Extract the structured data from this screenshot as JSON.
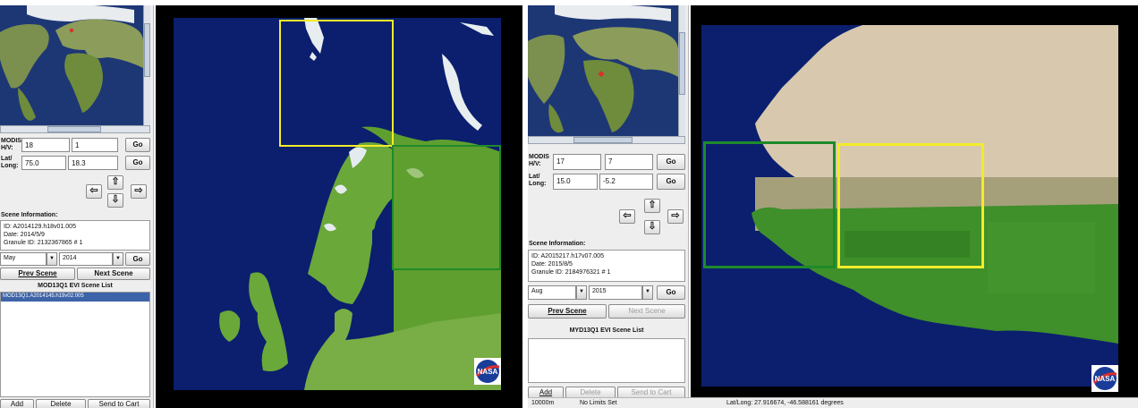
{
  "left": {
    "h_label": "MODIS\nH/V:",
    "h_value": "18",
    "v_value": "1",
    "latlong_label": "Lat/\nLong:",
    "lat_value": "75.0",
    "long_value": "18.3",
    "go_label": "Go",
    "arrows": {
      "up": "⇧",
      "down": "⇩",
      "left": "⇦",
      "right": "⇨"
    },
    "scene_info_title": "Scene Information:",
    "scene_id": "ID: A2014129.h18v01.005",
    "scene_date": "Date: 2014/5/9",
    "scene_granule": "Granule ID: 2132367865  # 1",
    "month": "May",
    "year": "2014",
    "prev_scene": "Prev Scene",
    "next_scene": "Next Scene",
    "scene_list_title": "MOD13Q1 EVI Scene List",
    "scene_list_items": [
      "MOD13Q1.A2014145.h19v02.005"
    ],
    "add": "Add",
    "delete": "Delete",
    "send_to_cart": "Send to Cart"
  },
  "right": {
    "h_label": "MODIS\nH/V:",
    "h_value": "17",
    "v_value": "7",
    "latlong_label": "Lat/\nLong:",
    "lat_value": "15.0",
    "long_value": "-5.2",
    "go_label": "Go",
    "arrows": {
      "up": "⇧",
      "down": "⇩",
      "left": "⇦",
      "right": "⇨"
    },
    "scene_info_title": "Scene Information:",
    "scene_id": "ID: A2015217.h17v07.005",
    "scene_date": "Date: 2015/8/5",
    "scene_granule": "Granule ID: 2184976321  # 1",
    "month": "Aug",
    "year": "2015",
    "prev_scene": "Prev Scene",
    "next_scene": "Next Scene",
    "scene_list_title": "MYD13Q1 EVI Scene List",
    "add": "Add",
    "delete": "Delete",
    "send_to_cart": "Send to Cart"
  },
  "status_bar": {
    "scale": "10000m",
    "limits": "No Limits Set",
    "latlong": "Lat/Long:  27.916674, -46.588161 degrees"
  },
  "colors": {
    "ocean": "#0b1f6e",
    "vegetation": "#4f9a2f",
    "desert": "#d8c9ae",
    "yellow_box": "#f2ec2a",
    "green_box": "#1f8a2a"
  },
  "icons": {
    "nasa_logo": "nasa-logo",
    "dropdown": "▼"
  }
}
